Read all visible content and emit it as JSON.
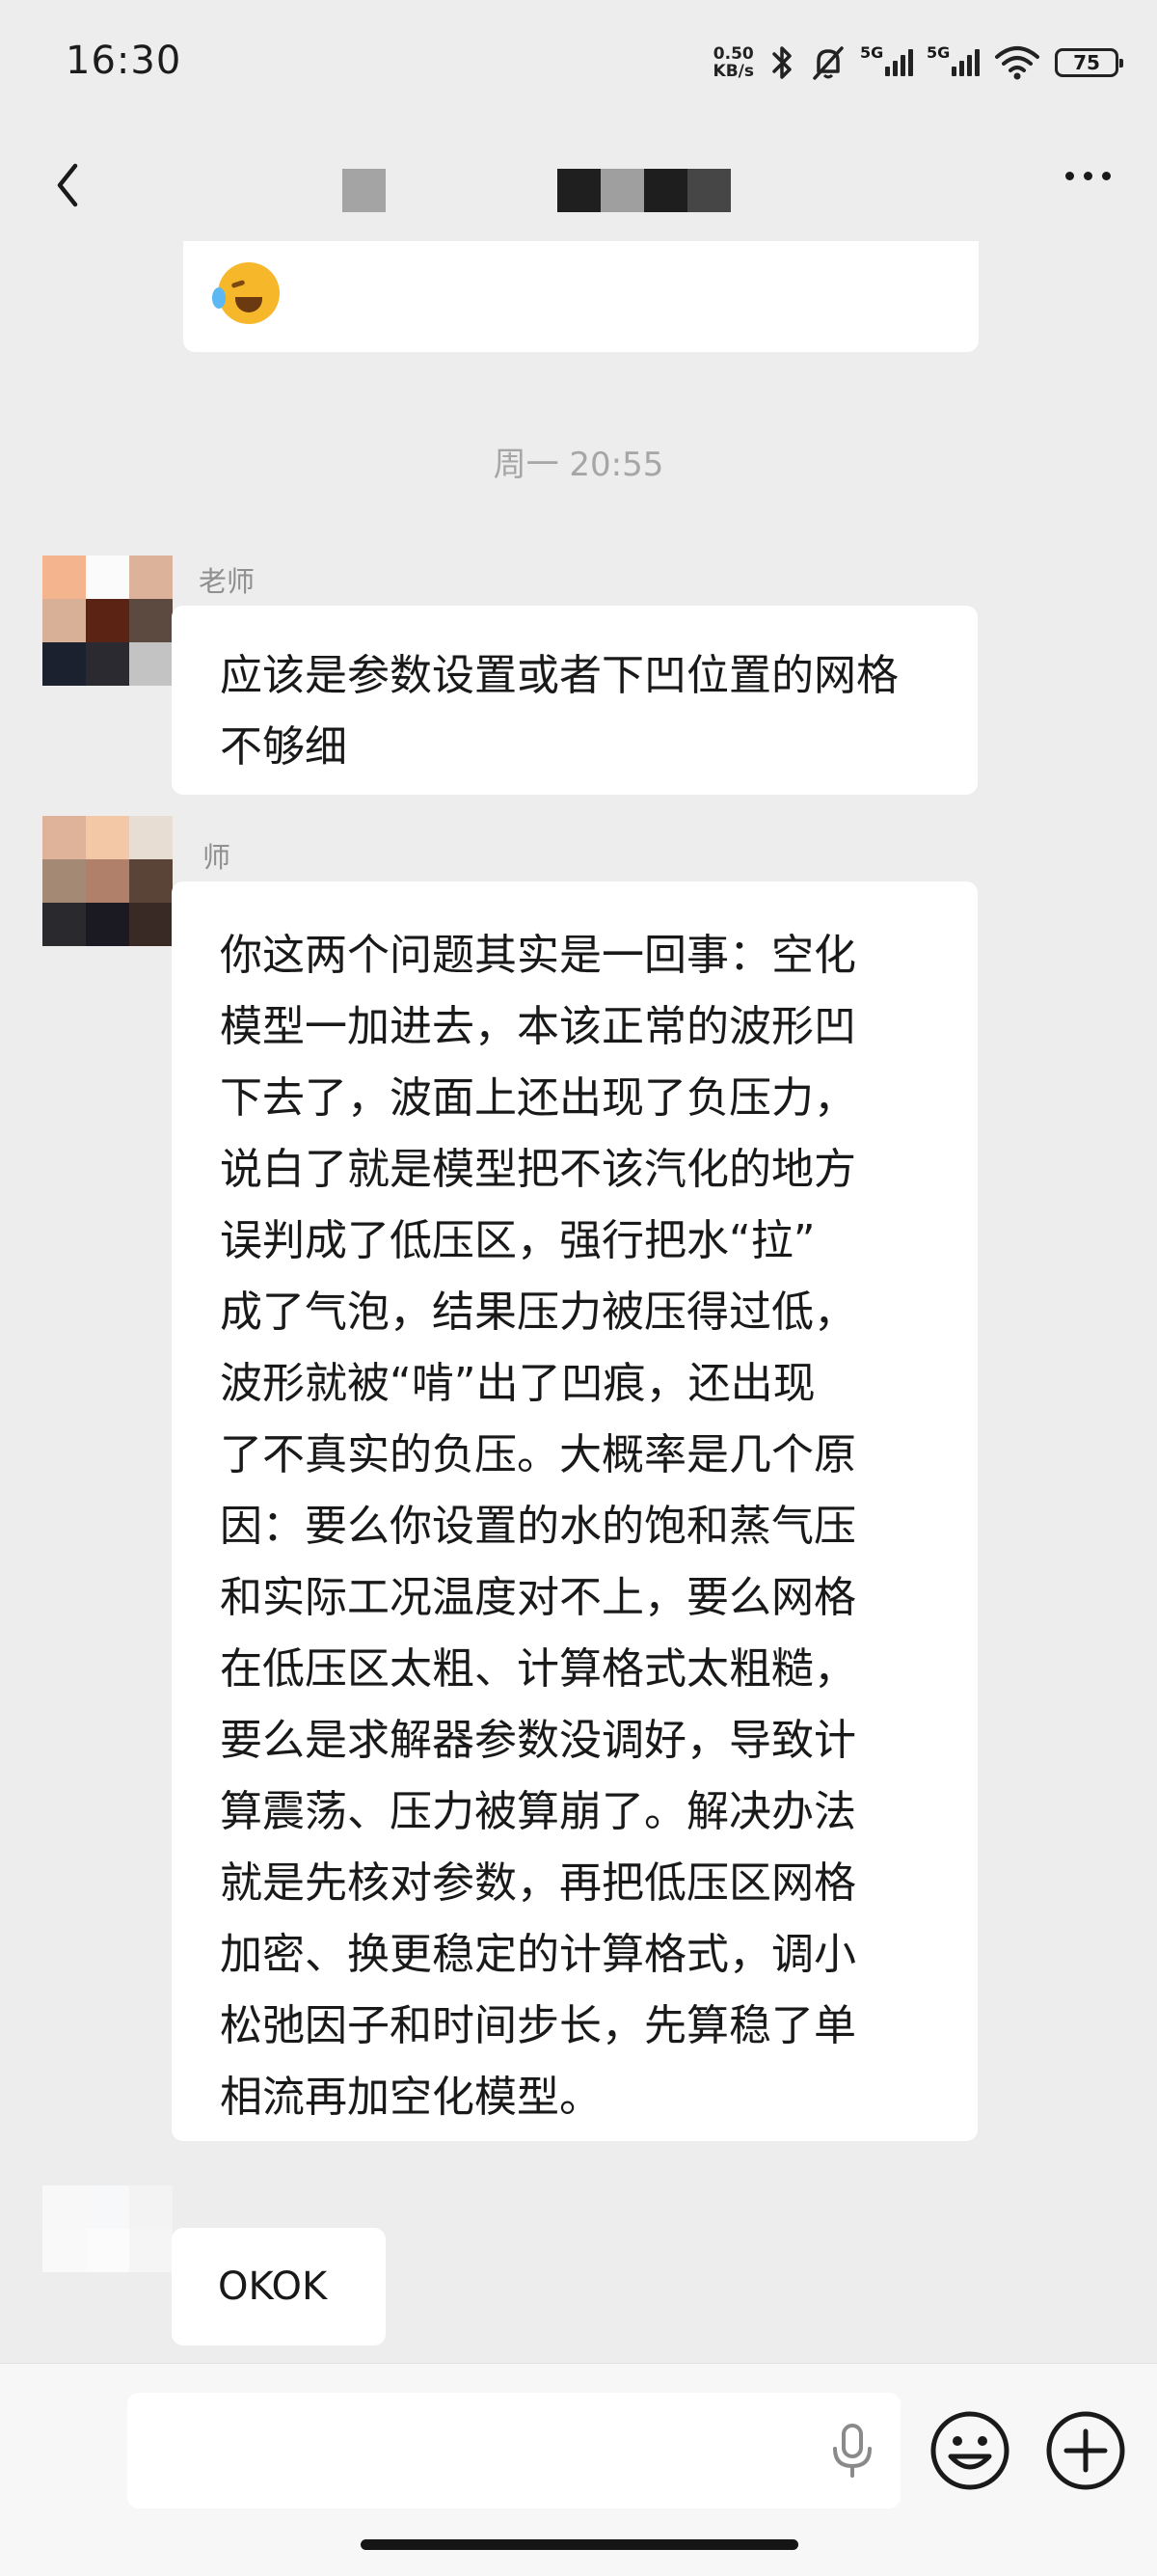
{
  "status_bar": {
    "time": "16:30",
    "net_speed_value": "0.50",
    "net_speed_unit": "KB/s",
    "sim1_label": "5G",
    "sim2_label": "5G",
    "battery": "75",
    "icons": [
      "bluetooth-icon",
      "mute-bell-icon",
      "signal-icon",
      "signal-icon",
      "wifi-icon",
      "battery-icon"
    ]
  },
  "header": {
    "icons": [
      "back-arrow-icon",
      "more-dots-icon"
    ]
  },
  "chat": {
    "timestamp": "周一 20:55",
    "messages": [
      {
        "sender": "老师",
        "text": "应该是参数设置或者下凹位置的网格不够细"
      },
      {
        "sender": "师",
        "lines": [
          "你这两个问题其实是一回事：空化",
          "模型一加进去，本该正常的波形凹",
          "下去了，波面上还出现了负压力，",
          "说白了就是模型把不该汽化的地方",
          "误判成了低压区，强行把水“拉”",
          "成了气泡，结果压力被压得过低，",
          "波形就被“啃”出了凹痕，还出现",
          "了不真实的负压。大概率是几个原",
          "因：要么你设置的水的饱和蒸气压",
          "和实际工况温度对不上，要么网格",
          "在低压区太粗、计算格式太粗糙，",
          "要么是求解器参数没调好，导致计",
          "算震荡、压力被算崩了。解决办法",
          "就是先核对参数，再把低压区网格",
          "加密、换更稳定的计算格式，调小",
          "松弛因子和时间步长，先算稳了单",
          "相流再加空化模型。"
        ]
      },
      {
        "sender": "",
        "text": "OKOK"
      }
    ]
  },
  "input_bar": {
    "icons": [
      "microphone-icon",
      "emoji-face-icon",
      "plus-circle-icon"
    ]
  }
}
